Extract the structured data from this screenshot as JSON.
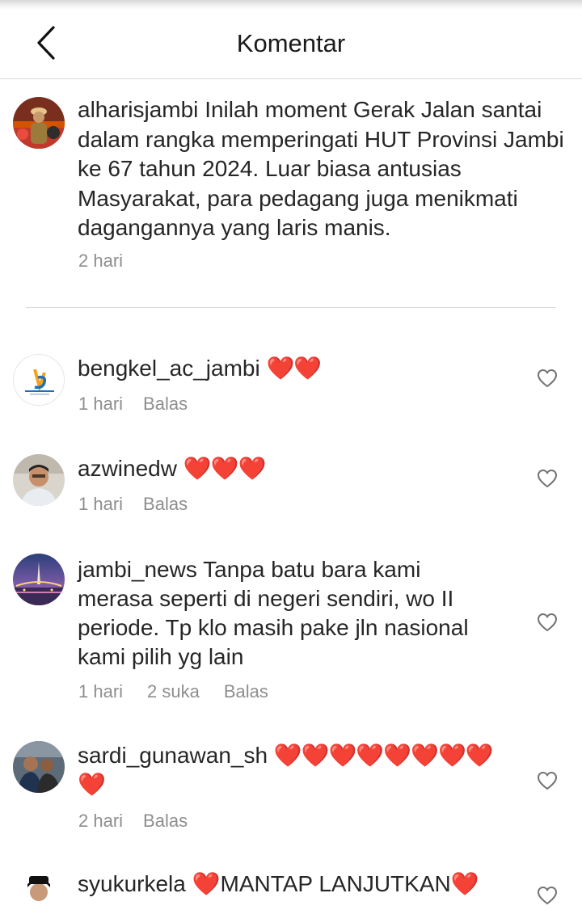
{
  "header": {
    "back_icon": "chevron-left-icon",
    "title": "Komentar"
  },
  "caption": {
    "username": "alharisjambi",
    "text": "Inilah moment Gerak Jalan santai dalam rangka memperingati HUT Provinsi Jambi ke 67 tahun 2024. Luar biasa antusias Masyarakat, para pedagang juga menikmati dagangannya yang laris manis.",
    "time": "2 hari"
  },
  "comments": [
    {
      "username": "bengkel_ac_jambi",
      "text": "❤️❤️",
      "time": "1 hari",
      "likes": "",
      "reply": "Balas"
    },
    {
      "username": "azwinedw",
      "text": "❤️❤️❤️",
      "time": "1 hari",
      "likes": "",
      "reply": "Balas"
    },
    {
      "username": "jambi_news",
      "text": "Tanpa batu bara kami merasa seperti di negeri sendiri, wo II periode. Tp klo masih pake jln nasional kami pilih yg lain",
      "time": "1 hari",
      "likes": "2 suka",
      "reply": "Balas"
    },
    {
      "username": "sardi_gunawan_sh",
      "text": "❤️❤️❤️❤️❤️❤️❤️❤️❤️",
      "time": "2 hari",
      "likes": "",
      "reply": "Balas"
    },
    {
      "username": "syukurkela",
      "text": "❤️MANTAP LANJUTKAN❤️",
      "time": "",
      "likes": "",
      "reply": ""
    }
  ],
  "colors": {
    "text": "#262626",
    "secondary": "#8e8e8e",
    "divider": "#dbdbdb",
    "heart": "#e0182d"
  },
  "icons": {
    "like": "heart-outline-icon"
  }
}
